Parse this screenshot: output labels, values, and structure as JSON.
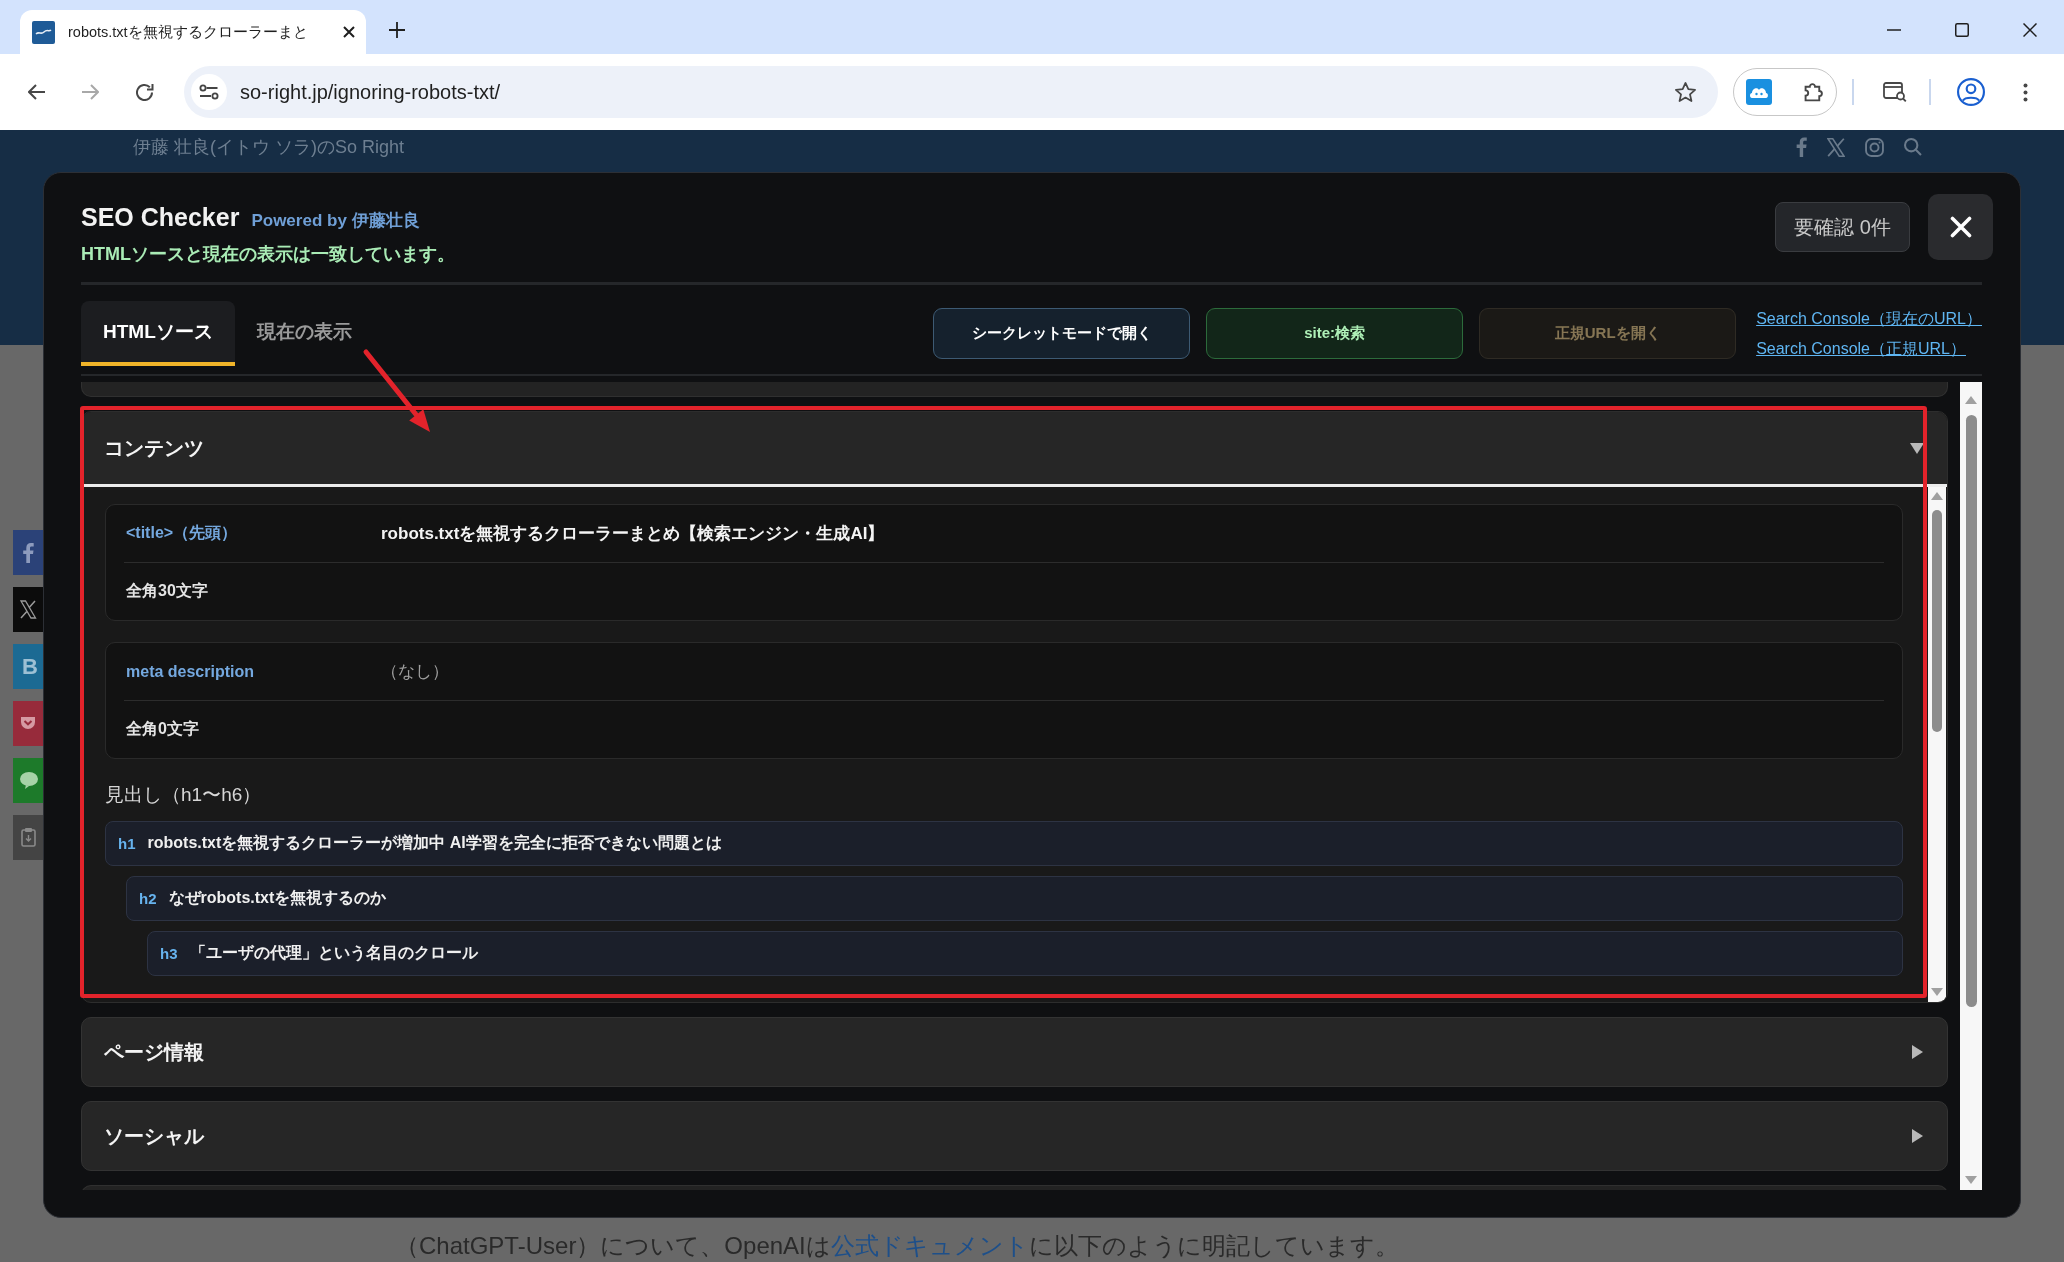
{
  "browser": {
    "tab_title": "robots.txtを無視するクローラーまと",
    "address": "so-right.jp/ignoring-robots-txt/"
  },
  "page": {
    "site_name": "伊藤 壮良(イトウ ソラ)のSo Right",
    "share_buttons": [
      {
        "kind": "facebook"
      },
      {
        "kind": "x"
      },
      {
        "kind": "hatena",
        "label": "B"
      },
      {
        "kind": "pocket"
      },
      {
        "kind": "line"
      },
      {
        "kind": "clipboard"
      }
    ],
    "paragraph": {
      "before": "（ChatGPT-User）について、OpenAIは",
      "link": "公式ドキュメント",
      "after": "に以下のように明記しています。"
    }
  },
  "checker": {
    "title": "SEO Checker",
    "powered_by": "Powered by 伊藤壮良",
    "status": "HTMLソースと現在の表示は一致しています。",
    "review_button": "要確認 0件",
    "tabs": [
      {
        "label": "HTMLソース",
        "selected": true
      },
      {
        "label": "現在の表示",
        "selected": false
      }
    ],
    "actions": [
      {
        "kind": "incognito",
        "label": "シークレットモードで開く",
        "disabled": false
      },
      {
        "kind": "site_search",
        "label": "site:検索",
        "disabled": false
      },
      {
        "kind": "canonical",
        "label": "正規URLを開く",
        "disabled": true
      }
    ],
    "links": [
      "Search Console（現在のURL）",
      "Search Console（正規URL）"
    ],
    "sections": [
      {
        "title": "コンテンツ",
        "expanded": true,
        "fields": [
          {
            "label": "<title>（先頭）",
            "value": "robots.txtを無視するクローラーまとめ【検索エンジン・生成AI】",
            "count": "全角30文字",
            "empty": false
          },
          {
            "label": "meta description",
            "value": "（なし）",
            "count": "全角0文字",
            "empty": true
          }
        ],
        "headings_title": "見出し（h1〜h6）",
        "headings": [
          {
            "level": "h1",
            "text": "robots.txtを無視するクローラーが増加中 AI学習を完全に拒否できない問題とは",
            "children": [
              {
                "level": "h2",
                "text": "なぜrobots.txtを無視するのか",
                "children": [
                  {
                    "level": "h3",
                    "text": "「ユーザの代理」という名目のクロール"
                  }
                ]
              }
            ]
          }
        ]
      },
      {
        "title": "ページ情報",
        "expanded": false
      },
      {
        "title": "ソーシャル",
        "expanded": false
      }
    ]
  }
}
